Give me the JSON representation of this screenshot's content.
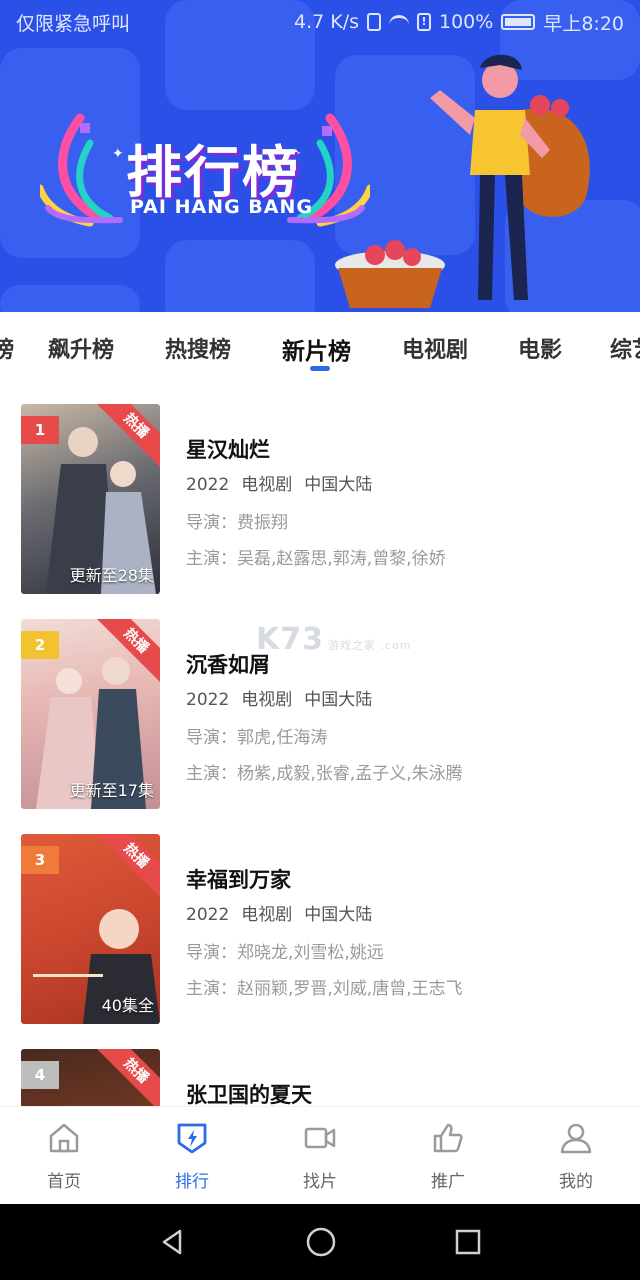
{
  "status_bar": {
    "left_text": "仅限紧急呼叫",
    "speed": "4.7 K/s",
    "battery": "100%",
    "time": "早上8:20"
  },
  "banner": {
    "title": "排行榜",
    "subtitle": "PAI HANG BANG"
  },
  "tabs": {
    "items": [
      {
        "label": "榜"
      },
      {
        "label": "飙升榜"
      },
      {
        "label": "热搜榜"
      },
      {
        "label": "新片榜"
      },
      {
        "label": "电视剧"
      },
      {
        "label": "电影"
      },
      {
        "label": "综艺"
      }
    ],
    "active_index": 3
  },
  "list": {
    "items": [
      {
        "rank": "1",
        "hot_label": "热播",
        "episode": "更新至28集",
        "title": "星汉灿烂",
        "year": "2022",
        "type": "电视剧",
        "region": "中国大陆",
        "director": "导演：费振翔",
        "cast": "主演：吴磊,赵露思,郭涛,曾黎,徐娇"
      },
      {
        "rank": "2",
        "hot_label": "热播",
        "episode": "更新至17集",
        "title": "沉香如屑",
        "year": "2022",
        "type": "电视剧",
        "region": "中国大陆",
        "director": "导演：郭虎,任海涛",
        "cast": "主演：杨紫,成毅,张睿,孟子义,朱泳腾"
      },
      {
        "rank": "3",
        "hot_label": "热播",
        "episode": "40集全",
        "title": "幸福到万家",
        "year": "2022",
        "type": "电视剧",
        "region": "中国大陆",
        "director": "导演：郑晓龙,刘雪松,姚远",
        "cast": "主演：赵丽颖,罗晋,刘威,唐曾,王志飞"
      },
      {
        "rank": "4",
        "hot_label": "热播",
        "episode": "",
        "title": "张卫国的夏天",
        "year": "",
        "type": "",
        "region": "",
        "director": "",
        "cast": ""
      }
    ]
  },
  "watermark": {
    "main": "K73",
    "sub": "游戏之家 .com"
  },
  "bottom_nav": {
    "items": [
      {
        "label": "首页",
        "icon": "home-icon"
      },
      {
        "label": "排行",
        "icon": "rank-shield-icon"
      },
      {
        "label": "找片",
        "icon": "video-camera-icon"
      },
      {
        "label": "推广",
        "icon": "thumbs-up-icon"
      },
      {
        "label": "我的",
        "icon": "user-icon"
      }
    ],
    "active_index": 1
  },
  "colors": {
    "banner_bg": "#2b50e8",
    "accent": "#2b6be8",
    "hot_ribbon": "#e64a4a",
    "rank1": "#e64a4a",
    "rank2": "#f2c230",
    "rank3": "#f07a3a",
    "rank4": "#bdbdbd"
  }
}
